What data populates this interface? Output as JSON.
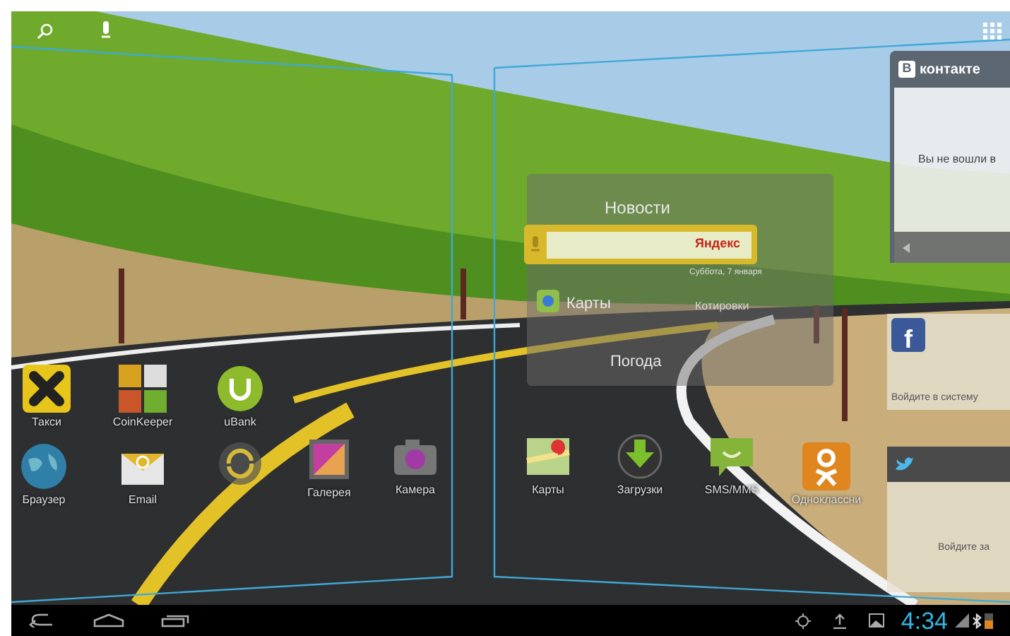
{
  "left_page": {
    "apps": [
      {
        "kind": "taxi",
        "label": "Такси"
      },
      {
        "kind": "coinkeeper",
        "label": "CoinKeeper"
      },
      {
        "kind": "bank",
        "label": "uBank"
      },
      {
        "kind": "browser",
        "label": "Браузер"
      },
      {
        "kind": "email",
        "label": "Email"
      },
      {
        "kind": "sync"
      },
      {
        "kind": "gallery",
        "label": "Галерея"
      },
      {
        "kind": "camera",
        "label": "Камера"
      }
    ]
  },
  "yandex_widget": {
    "title": "Новости",
    "search_logo": "Яндекс",
    "date": "Суббота, 7 января",
    "maps": "Карты",
    "quotes": "Котировки",
    "weather": "Погода"
  },
  "right_page": {
    "apps": [
      {
        "kind": "maps",
        "label": "Карты"
      },
      {
        "kind": "downloads",
        "label": "Загрузки"
      },
      {
        "kind": "sms",
        "label": "SMS/MMS"
      },
      {
        "kind": "ok",
        "label": "Одноклассни"
      }
    ]
  },
  "vk_widget": {
    "logo_letter": "В",
    "title": "контакте",
    "message": "Вы не вошли в"
  },
  "facebook_widget": {
    "logo_letter": "f",
    "message": "Войдите в систему"
  },
  "twitter_widget": {
    "message": "Войдите за"
  },
  "status_bar": {
    "time": "4:34"
  }
}
